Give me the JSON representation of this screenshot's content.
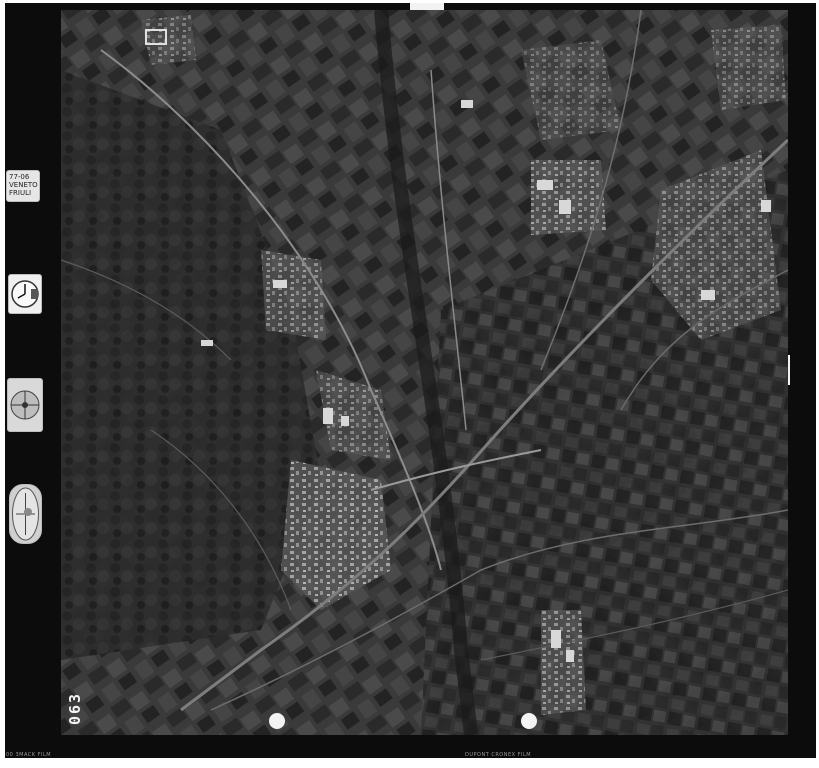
{
  "film_label": {
    "line1": "77-06",
    "line2": "VENETO",
    "line3": "FRIULI"
  },
  "frame_number": "063",
  "edge_text_left": "00 3MACK FILM",
  "edge_text_bottom": "DUPONT CRONEX FILM",
  "icons": {
    "clock": "clock-icon",
    "altimeter": "altimeter-icon",
    "level": "level-bubble-icon"
  },
  "colors": {
    "film_border": "#0c0c0c",
    "photo_base": "#3b3b3b",
    "paper": "#ffffff"
  }
}
